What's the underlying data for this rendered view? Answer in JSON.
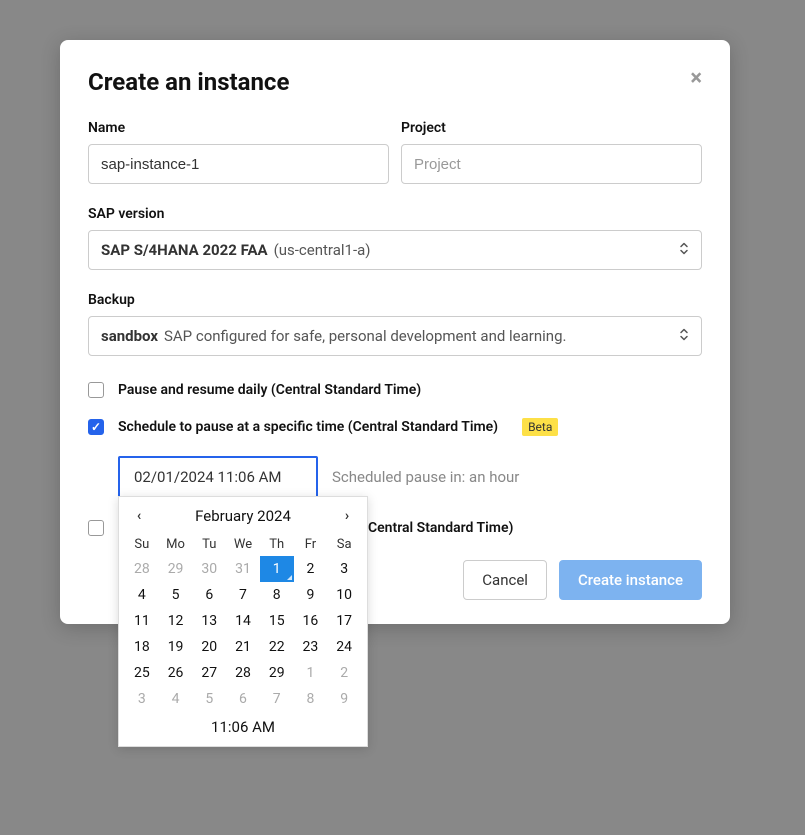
{
  "modal": {
    "title": "Create an instance",
    "name_label": "Name",
    "name_value": "sap-instance-1",
    "project_label": "Project",
    "project_placeholder": "Project",
    "project_value": "",
    "sap_version_label": "SAP version",
    "sap_version_bold": "SAP S/4HANA 2022 FAA",
    "sap_version_region": "(us-central1-a)",
    "backup_label": "Backup",
    "backup_bold": "sandbox",
    "backup_desc": "SAP configured for safe, personal development and learning.",
    "pause_daily_label": "Pause and resume daily (Central Standard Time)",
    "schedule_pause_label": "Schedule to pause at a specific time (Central Standard Time)",
    "beta_label": "Beta",
    "datetime_value": "02/01/2024 11:06 AM",
    "datetime_hint": "Scheduled pause in: an hour",
    "partial_label": "Central Standard Time)",
    "cancel_label": "Cancel",
    "create_label": "Create instance"
  },
  "calendar": {
    "month_label": "February 2024",
    "time_label": "11:06 AM",
    "dow": [
      "Su",
      "Mo",
      "Tu",
      "We",
      "Th",
      "Fr",
      "Sa"
    ],
    "days": [
      {
        "d": "28",
        "outside": true
      },
      {
        "d": "29",
        "outside": true
      },
      {
        "d": "30",
        "outside": true
      },
      {
        "d": "31",
        "outside": true
      },
      {
        "d": "1",
        "selected": true
      },
      {
        "d": "2"
      },
      {
        "d": "3"
      },
      {
        "d": "4"
      },
      {
        "d": "5"
      },
      {
        "d": "6"
      },
      {
        "d": "7"
      },
      {
        "d": "8"
      },
      {
        "d": "9"
      },
      {
        "d": "10"
      },
      {
        "d": "11"
      },
      {
        "d": "12"
      },
      {
        "d": "13"
      },
      {
        "d": "14"
      },
      {
        "d": "15"
      },
      {
        "d": "16"
      },
      {
        "d": "17"
      },
      {
        "d": "18"
      },
      {
        "d": "19"
      },
      {
        "d": "20"
      },
      {
        "d": "21"
      },
      {
        "d": "22"
      },
      {
        "d": "23"
      },
      {
        "d": "24"
      },
      {
        "d": "25"
      },
      {
        "d": "26"
      },
      {
        "d": "27"
      },
      {
        "d": "28"
      },
      {
        "d": "29"
      },
      {
        "d": "1",
        "outside": true
      },
      {
        "d": "2",
        "outside": true
      },
      {
        "d": "3",
        "outside": true
      },
      {
        "d": "4",
        "outside": true
      },
      {
        "d": "5",
        "outside": true
      },
      {
        "d": "6",
        "outside": true
      },
      {
        "d": "7",
        "outside": true
      },
      {
        "d": "8",
        "outside": true
      },
      {
        "d": "9",
        "outside": true
      }
    ]
  }
}
